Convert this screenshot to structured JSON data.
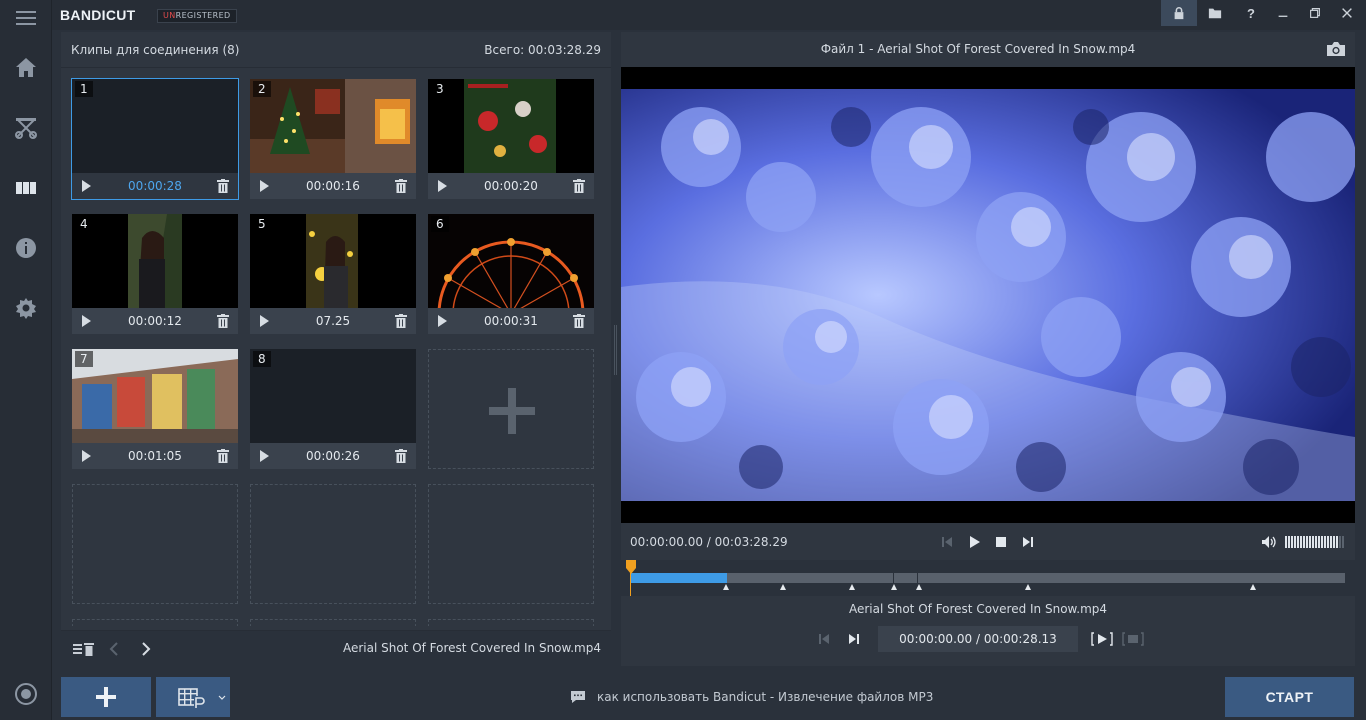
{
  "app": {
    "brand": "BANDICUT",
    "badge_prefix": "UN",
    "badge_rest": "REGISTERED"
  },
  "titlebar": {
    "help_label": "?"
  },
  "clips_panel": {
    "title": "Клипы для соединения (8)",
    "total": "Всего: 00:03:28.29",
    "clips": [
      {
        "num": "1",
        "duration": "00:00:28"
      },
      {
        "num": "2",
        "duration": "00:00:16"
      },
      {
        "num": "3",
        "duration": "00:00:20"
      },
      {
        "num": "4",
        "duration": "00:00:12"
      },
      {
        "num": "5",
        "duration": "07.25"
      },
      {
        "num": "6",
        "duration": "00:00:31"
      },
      {
        "num": "7",
        "duration": "00:01:05"
      },
      {
        "num": "8",
        "duration": "00:00:26"
      }
    ],
    "footer_filename": "Aerial Shot Of Forest Covered In Snow.mp4"
  },
  "preview": {
    "title": "Файл 1 - Aerial Shot Of Forest Covered In Snow.mp4",
    "time": "00:00:00.00 / 00:03:28.29",
    "volume_level": 0.9,
    "progress_fraction": 0.135,
    "segment_name": "Aerial Shot Of Forest Covered In Snow.mp4",
    "segment_time": "00:00:00.00 / 00:00:28.13"
  },
  "bottom": {
    "hint": "как использовать Bandicut - Извлечение файлов MP3",
    "start_label": "СТАРТ"
  },
  "colors": {
    "accent": "#3e9be6",
    "button": "#3a5a82",
    "marker": "#f0a020"
  }
}
